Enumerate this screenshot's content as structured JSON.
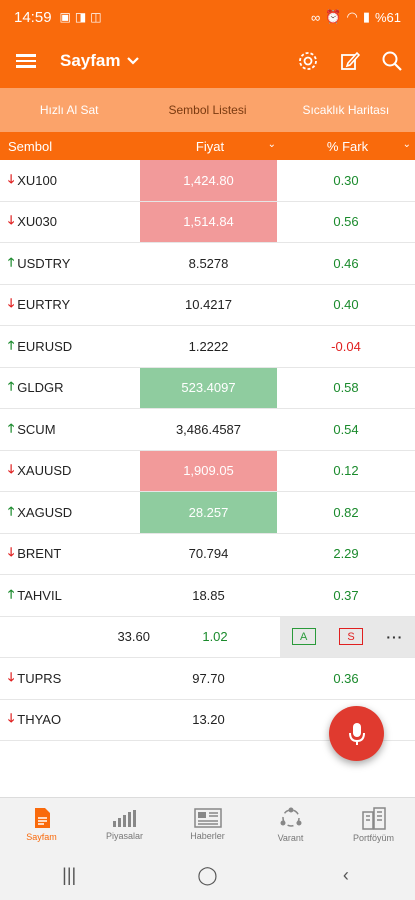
{
  "status": {
    "time": "14:59",
    "battery": "%61",
    "left_icons": [
      "image-icon",
      "cast-icon",
      "screenshot-icon"
    ],
    "right_icons": [
      "infinity-icon",
      "alarm-icon",
      "wifi-icon",
      "signal-icon"
    ]
  },
  "app_bar": {
    "title": "Sayfam"
  },
  "tabs": [
    {
      "label": "Hızlı Al Sat",
      "active": false
    },
    {
      "label": "Sembol Listesi",
      "active": true
    },
    {
      "label": "Sıcaklık Haritası",
      "active": false
    }
  ],
  "columns": {
    "symbol": "Sembol",
    "price": "Fiyat",
    "diff": "% Fark"
  },
  "rows": [
    {
      "symbol": "XU100",
      "direction": "down",
      "price": "1,424.80",
      "highlight": "red",
      "diff": "0.30",
      "diff_sign": "pos"
    },
    {
      "symbol": "XU030",
      "direction": "down",
      "price": "1,514.84",
      "highlight": "red",
      "diff": "0.56",
      "diff_sign": "pos"
    },
    {
      "symbol": "USDTRY",
      "direction": "up",
      "price": "8.5278",
      "highlight": "none",
      "diff": "0.46",
      "diff_sign": "pos"
    },
    {
      "symbol": "EURTRY",
      "direction": "down",
      "price": "10.4217",
      "highlight": "none",
      "diff": "0.40",
      "diff_sign": "pos"
    },
    {
      "symbol": "EURUSD",
      "direction": "up",
      "price": "1.2222",
      "highlight": "none",
      "diff": "-0.04",
      "diff_sign": "neg"
    },
    {
      "symbol": "GLDGR",
      "direction": "up",
      "price": "523.4097",
      "highlight": "green",
      "diff": "0.58",
      "diff_sign": "pos"
    },
    {
      "symbol": "SCUM",
      "direction": "up",
      "price": "3,486.4587",
      "highlight": "none",
      "diff": "0.54",
      "diff_sign": "pos"
    },
    {
      "symbol": "XAUUSD",
      "direction": "down",
      "price": "1,909.05",
      "highlight": "red",
      "diff": "0.12",
      "diff_sign": "pos"
    },
    {
      "symbol": "XAGUSD",
      "direction": "up",
      "price": "28.257",
      "highlight": "green",
      "diff": "0.82",
      "diff_sign": "pos"
    },
    {
      "symbol": "BRENT",
      "direction": "down",
      "price": "70.794",
      "highlight": "none",
      "diff": "2.29",
      "diff_sign": "pos"
    },
    {
      "symbol": "TAHVIL",
      "direction": "up",
      "price": "18.85",
      "highlight": "none",
      "diff": "0.37",
      "diff_sign": "pos"
    }
  ],
  "swipe_row": {
    "price": "33.60",
    "diff": "1.02",
    "buy_label": "A",
    "sell_label": "S",
    "more_label": "···"
  },
  "rows_after": [
    {
      "symbol": "TUPRS",
      "direction": "down",
      "price": "97.70",
      "highlight": "none",
      "diff": "0.36",
      "diff_sign": "pos"
    },
    {
      "symbol": "THYAO",
      "direction": "down",
      "price": "13.20",
      "highlight": "none",
      "diff": "",
      "diff_sign": "pos"
    }
  ],
  "bottom_nav": [
    {
      "label": "Sayfam",
      "icon": "page-icon",
      "active": true
    },
    {
      "label": "Piyasalar",
      "icon": "market-chart-icon",
      "active": false
    },
    {
      "label": "Haberler",
      "icon": "news-icon",
      "active": false
    },
    {
      "label": "Varant",
      "icon": "warrant-icon",
      "active": false
    },
    {
      "label": "Portföyüm",
      "icon": "portfolio-icon",
      "active": false
    }
  ],
  "colors": {
    "brand": "#f96a0c",
    "tab_bg": "#fba36a",
    "up_green": "#1a8a2c",
    "down_red": "#e02020",
    "red_cell": "#f29a9a",
    "green_cell": "#8fcc9f",
    "fab": "#e03a2f"
  }
}
